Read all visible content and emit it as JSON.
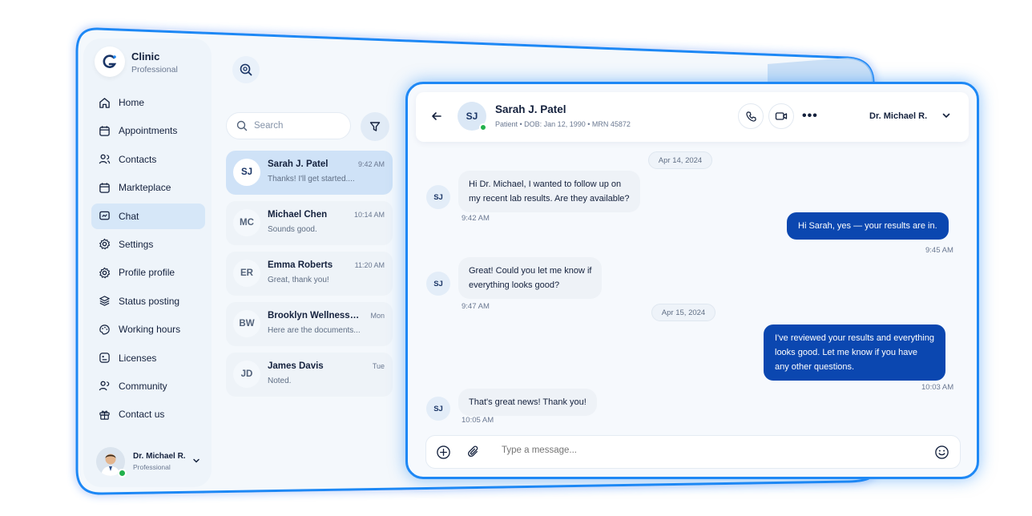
{
  "app": {
    "name": "Clinic",
    "plan": "Professional"
  },
  "sidebar": {
    "items": [
      {
        "label": "Home",
        "icon": "home-icon"
      },
      {
        "label": "Appointments",
        "icon": "calendar-icon"
      },
      {
        "label": "Contacts",
        "icon": "contacts-icon"
      },
      {
        "label": "Markteplace",
        "icon": "calendar-icon"
      },
      {
        "label": "Chat",
        "icon": "chat-icon",
        "active": true
      },
      {
        "label": "Settings",
        "icon": "gear-icon"
      },
      {
        "label": "Profile profile",
        "icon": "gear-icon"
      },
      {
        "label": "Status posting",
        "icon": "layers-icon"
      },
      {
        "label": "Working hours",
        "icon": "palette-icon"
      },
      {
        "label": "Licenses",
        "icon": "license-icon"
      },
      {
        "label": "Community",
        "icon": "community-icon"
      },
      {
        "label": "Contact us",
        "icon": "gift-icon"
      }
    ],
    "user": {
      "name": "Dr. Michael R.",
      "role": "Professional"
    }
  },
  "search": {
    "placeholder": "Search"
  },
  "conversations": [
    {
      "initials": "SJ",
      "name": "Sarah J. Patel",
      "preview": "Thanks! I'll get started....",
      "time": "9:42 AM",
      "active": true
    },
    {
      "initials": "MC",
      "name": "Michael Chen",
      "preview": "Sounds good.",
      "time": "10:14 AM"
    },
    {
      "initials": "ER",
      "name": "Emma Roberts",
      "preview": "Great, thank you!",
      "time": "11:20 AM"
    },
    {
      "initials": "BW",
      "name": "Brooklyn Wellness C...",
      "preview": "Here are the documents...",
      "time": "Mon"
    },
    {
      "initials": "JD",
      "name": "James Davis",
      "preview": "Noted.",
      "time": "Tue"
    }
  ],
  "chat": {
    "header": {
      "initials": "SJ",
      "name": "Sarah J. Patel",
      "meta": "Patient • DOB: Jan 12, 1990 • MRN 45872",
      "more": "•••",
      "doctor": "Dr. Michael R."
    },
    "dates": [
      "Apr 14, 2024",
      "Apr 15, 2024"
    ],
    "messages": [
      {
        "dir": "in",
        "initials": "SJ",
        "lines": [
          "Hi Dr. Michael, I wanted to follow up on",
          "my recent lab results. Are they available?"
        ],
        "time": "9:42 AM"
      },
      {
        "dir": "out",
        "lines": [
          "Hi Sarah, yes — your results are in."
        ],
        "time": "9:45 AM"
      },
      {
        "dir": "in",
        "initials": "SJ",
        "lines": [
          "Great! Could you let me know if",
          "everything looks good?"
        ],
        "time": "9:47 AM"
      },
      {
        "dir": "out",
        "lines": [
          "I've reviewed your results and everything",
          "looks good. Let me know if you have",
          "any other questions."
        ],
        "time": "10:03 AM"
      },
      {
        "dir": "in",
        "initials": "SJ",
        "lines": [
          "That's great news! Thank you!"
        ],
        "time": "10:05 AM"
      }
    ],
    "composer": {
      "placeholder": "Type a message..."
    }
  },
  "colors": {
    "accent": "#1e88f5",
    "outgoing_bubble": "#0b47b0",
    "online": "#22b14c",
    "active_item": "#d6e7f8"
  }
}
